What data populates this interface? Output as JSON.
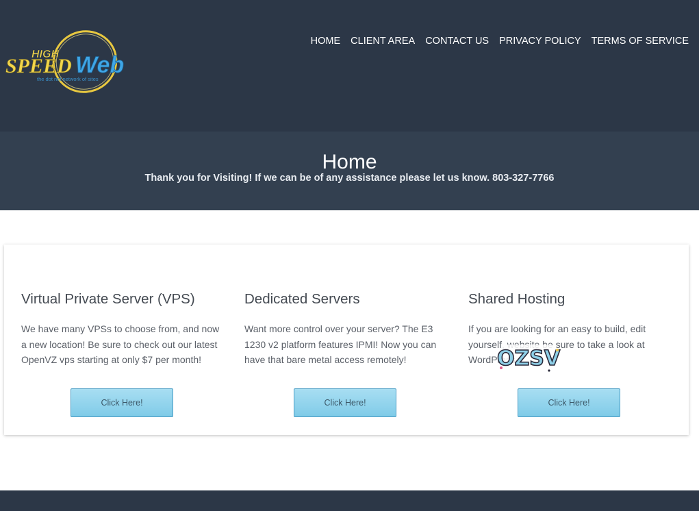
{
  "logo": {
    "word_high": "HIGH",
    "word_speed": "SPEED",
    "word_web": "Web",
    "tagline": "the dot net network of sites"
  },
  "nav": {
    "items": [
      {
        "label": "HOME"
      },
      {
        "label": "CLIENT AREA"
      },
      {
        "label": "CONTACT US"
      },
      {
        "label": "PRIVACY POLICY"
      },
      {
        "label": "TERMS OF SERVICE"
      }
    ]
  },
  "banner": {
    "title": "Home",
    "subtitle": "Thank you for Visiting! If we can be of any assistance please let us know. 803-327-7766"
  },
  "services": [
    {
      "title": "Virtual Private Server (VPS)",
      "description": "We have many VPSs to choose from, and now a new location! Be sure to check out our latest OpenVZ vps starting at only $7 per month!",
      "button": "Click Here!"
    },
    {
      "title": "Dedicated Servers",
      "description": "Want more control over your server? The E3 1230 v2 platform features IPMI! Now you can have that bare metal access remotely!",
      "button": "Click Here!"
    },
    {
      "title": "Shared Hosting",
      "description": "If you are looking for an easy to build, edit yourself, website be sure to take a look at WordPress",
      "button": "Click Here!"
    }
  ],
  "sticker": {
    "text": "OZSV"
  },
  "colors": {
    "header_bg": "#2c3747",
    "banner_bg": "#334050",
    "button_bg": "#8dd3ee",
    "text_body": "#5b6068"
  }
}
